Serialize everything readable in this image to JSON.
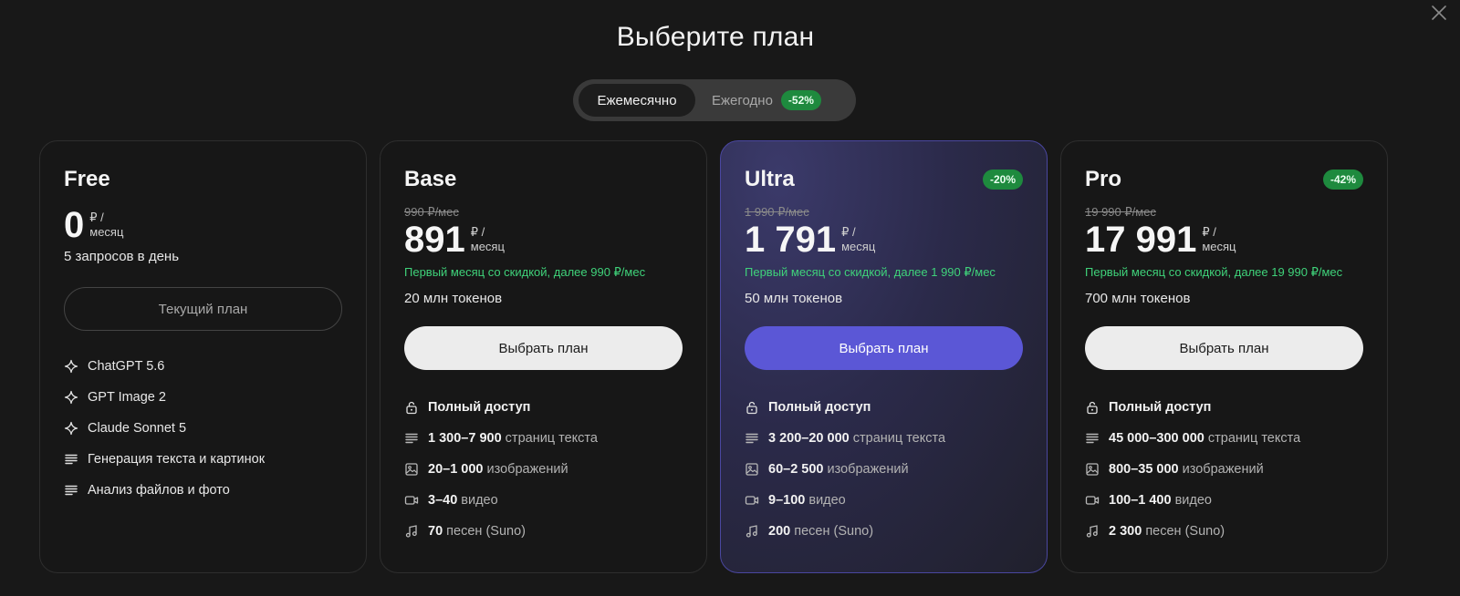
{
  "title": "Выберите план",
  "billing": {
    "monthly": "Ежемесячно",
    "yearly": "Ежегодно",
    "yearly_badge": "-52%"
  },
  "plans": {
    "free": {
      "name": "Free",
      "price": "0",
      "unit_line1": "₽ /",
      "unit_line2": "месяц",
      "requests": "5 запросов в день",
      "button": "Текущий план",
      "features": [
        {
          "icon": "sparkle-icon",
          "text": "ChatGPT 5.6"
        },
        {
          "icon": "sparkle-icon",
          "text": "GPT Image 2"
        },
        {
          "icon": "sparkle-icon",
          "text": "Claude Sonnet 5"
        },
        {
          "icon": "text-lines-icon",
          "text": "Генерация текста и картинок"
        },
        {
          "icon": "text-lines-icon",
          "text": "Анализ файлов и фото"
        }
      ]
    },
    "base": {
      "name": "Base",
      "old_price": "990 ₽/мес",
      "price": "891",
      "unit_line1": "₽ /",
      "unit_line2": "месяц",
      "promo": "Первый месяц со скидкой, далее 990 ₽/мес",
      "tokens": "20 млн токенов",
      "button": "Выбрать план",
      "features": {
        "access": "Полный доступ",
        "pages_value": "1 300–7 900",
        "pages_label": "страниц текста",
        "images_value": "20–1 000",
        "images_label": "изображений",
        "video_value": "3–40",
        "video_label": "видео",
        "songs_value": "70",
        "songs_label": "песен (Suno)"
      }
    },
    "ultra": {
      "name": "Ultra",
      "badge": "-20%",
      "old_price": "1 990 ₽/мес",
      "price": "1 791",
      "unit_line1": "₽ /",
      "unit_line2": "месяц",
      "promo": "Первый месяц со скидкой, далее 1 990 ₽/мес",
      "tokens": "50 млн токенов",
      "button": "Выбрать план",
      "features": {
        "access": "Полный доступ",
        "pages_value": "3 200–20 000",
        "pages_label": "страниц текста",
        "images_value": "60–2 500",
        "images_label": "изображений",
        "video_value": "9–100",
        "video_label": "видео",
        "songs_value": "200",
        "songs_label": "песен (Suno)"
      }
    },
    "pro": {
      "name": "Pro",
      "badge": "-42%",
      "old_price": "19 990 ₽/мес",
      "price": "17 991",
      "unit_line1": "₽ /",
      "unit_line2": "месяц",
      "promo": "Первый месяц со скидкой, далее 19 990 ₽/мес",
      "tokens": "700 млн токенов",
      "button": "Выбрать план",
      "features": {
        "access": "Полный доступ",
        "pages_value": "45 000–300 000",
        "pages_label": "страниц текста",
        "images_value": "800–35 000",
        "images_label": "изображений",
        "video_value": "100–1 400",
        "video_label": "видео",
        "songs_value": "2 300",
        "songs_label": "песен (Suno)"
      }
    }
  },
  "colors": {
    "background": "#181818",
    "accent_purple": "#5b57d6",
    "discount_green": "#1e8a3e",
    "promo_green": "#3fd27a"
  }
}
